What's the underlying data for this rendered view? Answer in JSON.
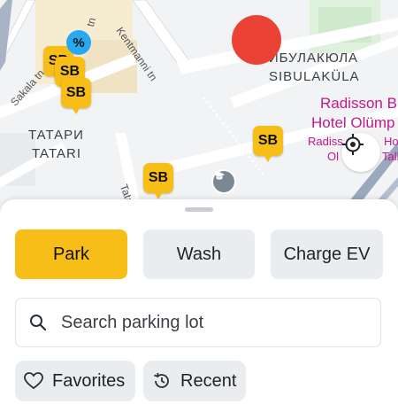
{
  "map": {
    "district_labels": {
      "tatari_cyrillic": "ТАТАРИ",
      "tatari_latin": "TATARI",
      "sibulakula_cyrillic": "СИБУЛАКЮЛА",
      "sibulakula_latin": "SIBULAKÜLA"
    },
    "streets": {
      "sakala": "Sakala tn",
      "kentmanni": "Kentmanni tn",
      "tatari_street": "Tatari tn",
      "partial_left": "tn"
    },
    "poi": {
      "line1": "Radisson B",
      "line2": "Hotel Olümp",
      "small1": "Radiss",
      "small1b": "Ho",
      "small2": "Ol",
      "small2b": "Talli"
    },
    "parking_pins": [
      "SB",
      "SB",
      "SB",
      "SB",
      "SB"
    ],
    "discount_badge": "%",
    "accent": "#f8be18",
    "discount_color": "#27a9f2",
    "marker_color": "#ea4335"
  },
  "tabs": [
    {
      "label": "Park",
      "active": true
    },
    {
      "label": "Wash",
      "active": false
    },
    {
      "label": "Charge EV",
      "active": false
    }
  ],
  "search": {
    "placeholder": "Search parking lot",
    "value": ""
  },
  "chips": [
    {
      "label": "Favorites",
      "icon": "heart-icon"
    },
    {
      "label": "Recent",
      "icon": "history-icon"
    }
  ]
}
